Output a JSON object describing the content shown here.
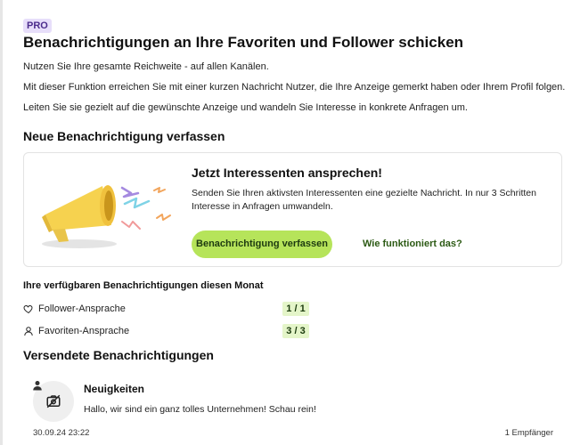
{
  "header": {
    "badge": "PRO",
    "title": "Benachrichtigungen an Ihre Favoriten und Follower schicken",
    "intro": [
      "Nutzen Sie Ihre gesamte Reichweite - auf allen Kanälen.",
      "Mit dieser Funktion erreichen Sie mit einer kurzen Nachricht Nutzer, die Ihre Anzeige gemerkt haben oder Ihrem Profil folgen.",
      "Leiten Sie sie gezielt auf die gewünschte Anzeige und wandeln Sie Interesse in konkrete Anfragen um."
    ]
  },
  "compose": {
    "heading": "Neue Benachrichtigung verfassen",
    "card": {
      "title": "Jetzt Interessenten ansprechen!",
      "text": "Senden Sie Ihren aktivsten Interessenten eine gezielte Nachricht. In nur 3 Schritten Interesse in Anfragen umwandeln.",
      "primary_button": "Benachrichtigung verfassen",
      "help_link": "Wie funktioniert das?",
      "illustration": "megaphone-illustration"
    }
  },
  "quota": {
    "heading": "Ihre verfügbaren Benachrichtigungen diesen Monat",
    "items": [
      {
        "icon": "heart-icon",
        "label": "Follower-Ansprache",
        "count": "1 / 1"
      },
      {
        "icon": "person-icon",
        "label": "Favoriten-Ansprache",
        "count": "3 / 3"
      }
    ]
  },
  "sent": {
    "heading": "Versendete Benachrichtigungen",
    "messages": [
      {
        "title": "Neuigkeiten",
        "text": "Hallo, wir sind ein ganz tolles Unternehmen! Schau rein!",
        "date": "30.09.24 23:22",
        "recipients": "1 Empfänger",
        "avatar_icon": "no-image-icon",
        "type_icon": "person-icon"
      }
    ]
  },
  "colors": {
    "accent_green": "#b6e45a",
    "count_bg": "#e4f5c9",
    "badge_bg": "#e7defa",
    "link_green": "#2c5a14"
  }
}
